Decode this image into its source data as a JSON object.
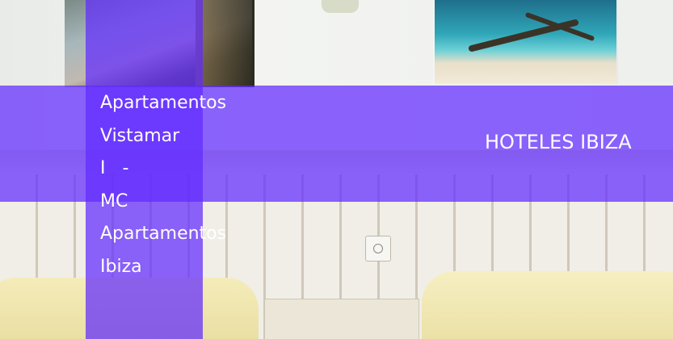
{
  "hero": {
    "title_lines": [
      "Apartamentos",
      "Vistamar",
      "I   -",
      "MC",
      "Apartamentos",
      "Ibiza"
    ],
    "category": "HOTELES IBIZA"
  },
  "colors": {
    "overlay": "#612aff",
    "text": "#ffffff"
  }
}
